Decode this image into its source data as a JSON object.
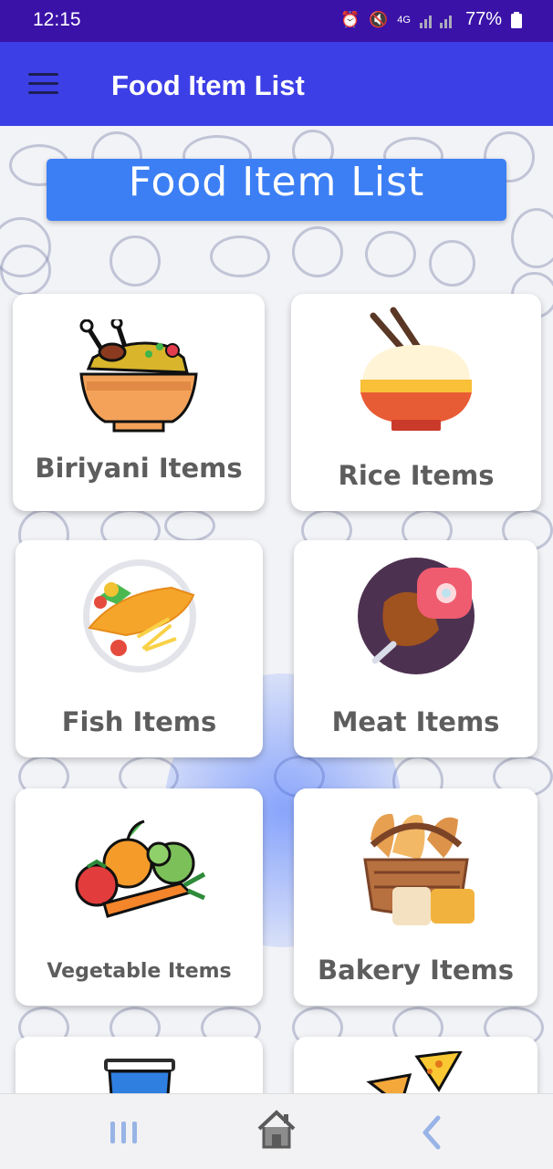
{
  "status_bar": {
    "time": "12:15",
    "signal_label": "4G",
    "battery": "77%",
    "icons": [
      "alarm-icon",
      "mute-icon",
      "signal-icon",
      "battery-icon"
    ]
  },
  "app_bar": {
    "title": "Food Item List",
    "menu_icon": "hamburger-menu-icon",
    "color": "#3d3fe6"
  },
  "banner": {
    "title": "Food Item  List",
    "color": "#3c7ff5"
  },
  "categories": [
    {
      "label": "Biriyani Items",
      "icon": "biriyani-bowl-icon"
    },
    {
      "label": "Rice Items",
      "icon": "rice-bowl-icon"
    },
    {
      "label": "Fish Items",
      "icon": "fish-plate-icon"
    },
    {
      "label": "Meat Items",
      "icon": "meat-icon"
    },
    {
      "label": "Vegetable Items",
      "icon": "vegetables-icon"
    },
    {
      "label": "Bakery Items",
      "icon": "bread-basket-icon"
    },
    {
      "label": "",
      "icon": "drink-cup-icon"
    },
    {
      "label": "",
      "icon": "nachos-icon"
    }
  ],
  "nav_bar": {
    "buttons": [
      "recent-apps-icon",
      "home-icon",
      "back-icon"
    ]
  }
}
